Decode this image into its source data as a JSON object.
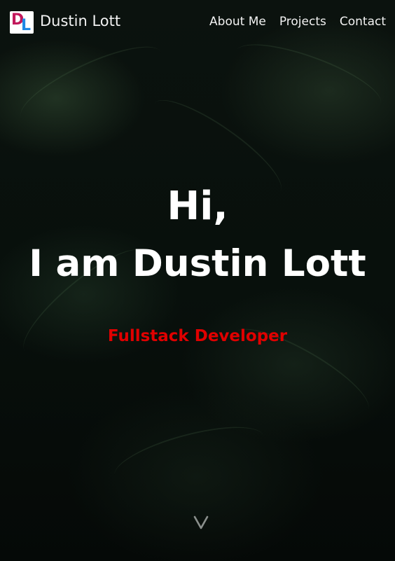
{
  "header": {
    "logo": {
      "letter1": "D",
      "letter2": "L"
    },
    "brand_name": "Dustin Lott",
    "nav": [
      {
        "label": "About Me"
      },
      {
        "label": "Projects"
      },
      {
        "label": "Contact"
      }
    ]
  },
  "hero": {
    "greeting": "Hi,",
    "intro": "I am Dustin Lott",
    "role": "Fullstack Developer",
    "scroll_icon": "chevron-down-icon"
  },
  "colors": {
    "role_accent": "#e00000",
    "logo_d": "#c2185b",
    "logo_l": "#1e88e5",
    "text": "#ffffff"
  }
}
